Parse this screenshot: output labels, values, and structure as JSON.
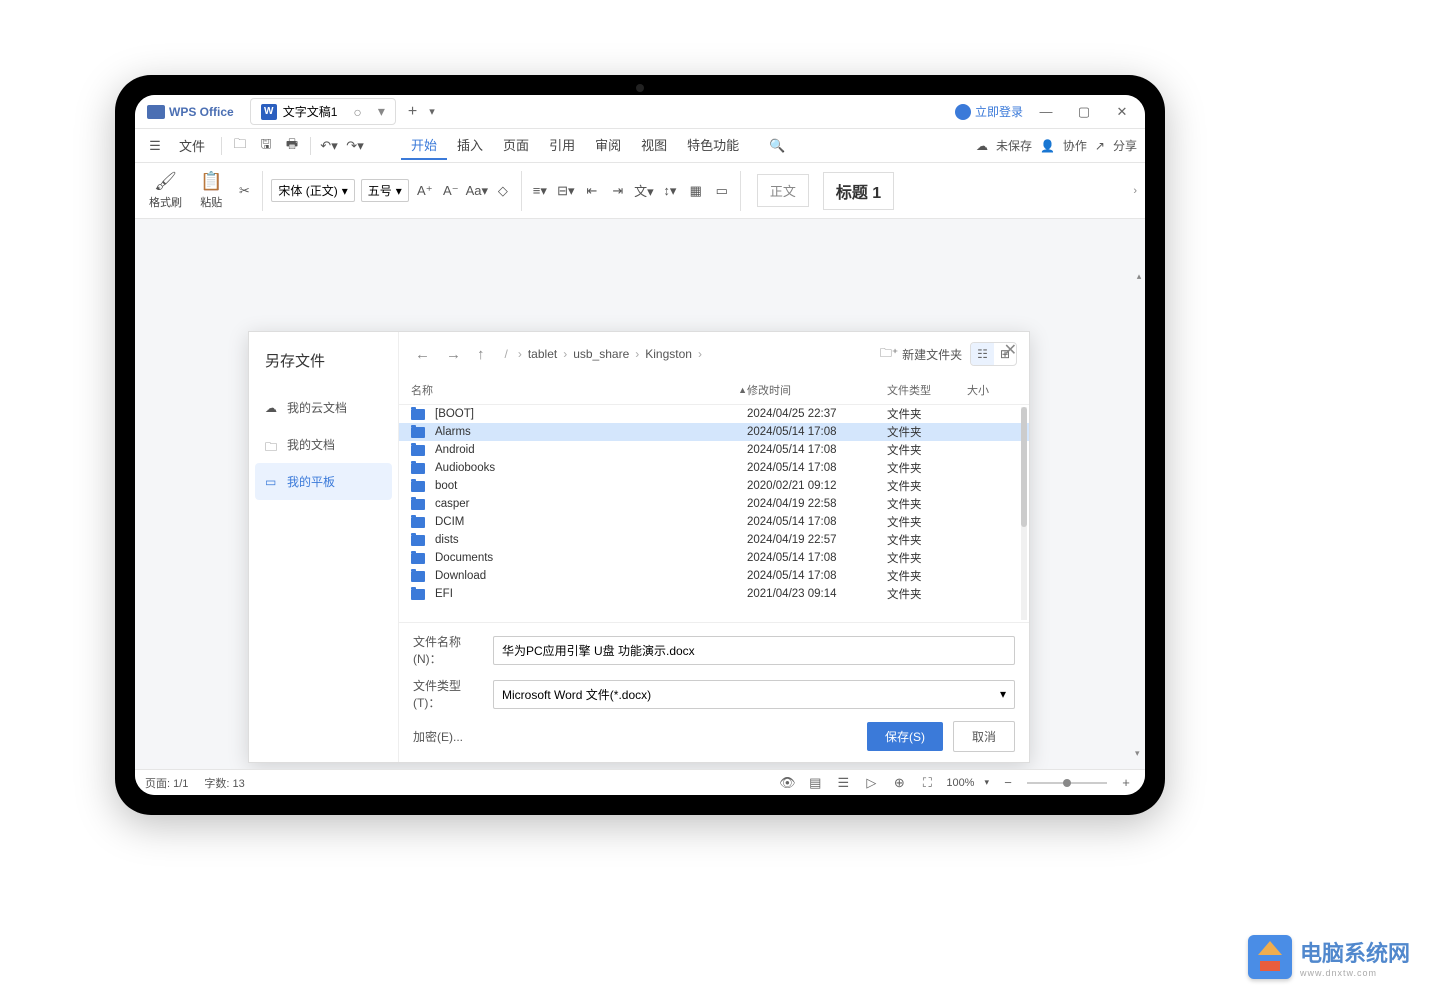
{
  "app": {
    "name": "WPS Office",
    "tab_label": "文字文稿1",
    "doc_icon": "W"
  },
  "titlebar_right": {
    "login": "立即登录"
  },
  "menubar": {
    "file": "文件",
    "items": [
      "开始",
      "插入",
      "页面",
      "引用",
      "审阅",
      "视图",
      "特色功能"
    ],
    "active_index": 0,
    "unsaved": "未保存",
    "collab": "协作",
    "share": "分享"
  },
  "ribbon": {
    "format_brush": "格式刷",
    "paste": "粘贴",
    "font_name": "宋体 (正文)",
    "font_size": "五号",
    "style_normal": "正文",
    "style_heading": "标题 1"
  },
  "dialog": {
    "title": "另存文件",
    "sidebar": [
      {
        "icon": "cloud",
        "label": "我的云文档"
      },
      {
        "icon": "folder",
        "label": "我的文档"
      },
      {
        "icon": "tablet",
        "label": "我的平板"
      }
    ],
    "active_sidebar_index": 2,
    "breadcrumb": [
      "tablet",
      "usb_share",
      "Kingston"
    ],
    "new_folder": "新建文件夹",
    "columns": {
      "name": "名称",
      "date": "修改时间",
      "type": "文件类型",
      "size": "大小"
    },
    "files": [
      {
        "name": "[BOOT]",
        "date": "2024/04/25 22:37",
        "type": "文件夹",
        "selected": false
      },
      {
        "name": "Alarms",
        "date": "2024/05/14 17:08",
        "type": "文件夹",
        "selected": true
      },
      {
        "name": "Android",
        "date": "2024/05/14 17:08",
        "type": "文件夹",
        "selected": false
      },
      {
        "name": "Audiobooks",
        "date": "2024/05/14 17:08",
        "type": "文件夹",
        "selected": false
      },
      {
        "name": "boot",
        "date": "2020/02/21 09:12",
        "type": "文件夹",
        "selected": false
      },
      {
        "name": "casper",
        "date": "2024/04/19 22:58",
        "type": "文件夹",
        "selected": false
      },
      {
        "name": "DCIM",
        "date": "2024/05/14 17:08",
        "type": "文件夹",
        "selected": false
      },
      {
        "name": "dists",
        "date": "2024/04/19 22:57",
        "type": "文件夹",
        "selected": false
      },
      {
        "name": "Documents",
        "date": "2024/05/14 17:08",
        "type": "文件夹",
        "selected": false
      },
      {
        "name": "Download",
        "date": "2024/05/14 17:08",
        "type": "文件夹",
        "selected": false
      },
      {
        "name": "EFI",
        "date": "2021/04/23 09:14",
        "type": "文件夹",
        "selected": false
      }
    ],
    "filename_label": "文件名称(N)：",
    "filename_value": "华为PC应用引擎 U盘 功能演示.docx",
    "filetype_label": "文件类型(T)：",
    "filetype_value": "Microsoft Word 文件(*.docx)",
    "encrypt": "加密(E)...",
    "save": "保存(S)",
    "cancel": "取消"
  },
  "statusbar": {
    "page": "页面: 1/1",
    "words": "字数: 13",
    "zoom": "100%"
  },
  "watermark": {
    "text": "电脑系统网",
    "sub": "www.dnxtw.com"
  }
}
